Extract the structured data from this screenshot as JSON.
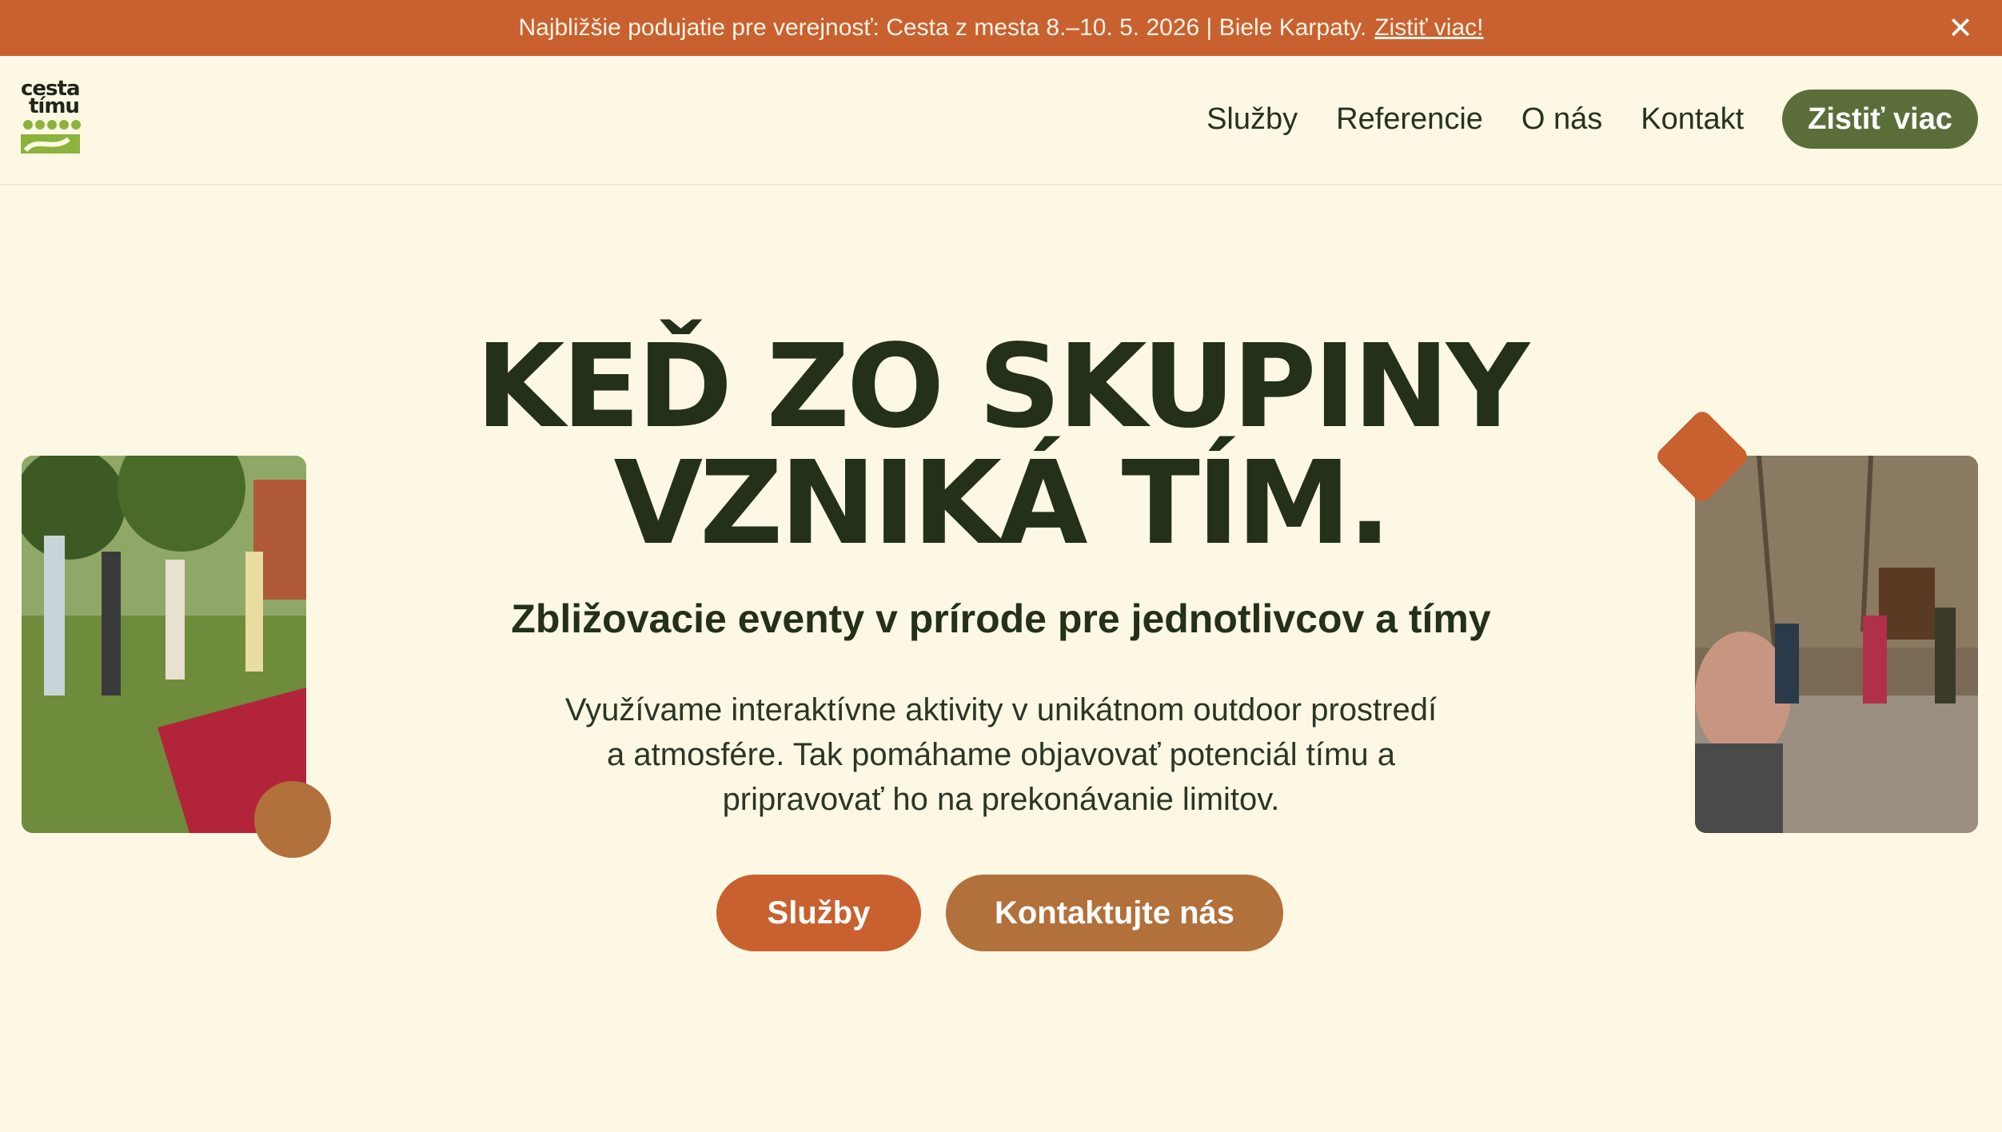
{
  "announcement": {
    "text": "Najbližšie podujatie pre verejnosť: Cesta z mesta 8.–10. 5. 2026 | Biele Karpaty.",
    "link": "Zistiť viac!",
    "close_icon": "close-icon"
  },
  "logo": {
    "line1": "cesta",
    "line2": "tímu"
  },
  "nav": {
    "items": [
      {
        "label": "Služby"
      },
      {
        "label": "Referencie"
      },
      {
        "label": "O nás"
      },
      {
        "label": "Kontakt"
      }
    ],
    "cta": "Zistiť viac"
  },
  "hero": {
    "title_line1": "KEĎ ZO SKUPINY",
    "title_line2": "VZNIKÁ TÍM.",
    "subtitle": "Zbližovacie eventy v prírode pre jednotlivcov a tímy",
    "desc_line1": "Využívame interaktívne aktivity v unikátnom outdoor prostredí",
    "desc_line2": "a atmosfére. Tak pomáhame objavovať potenciál tímu a",
    "desc_line3": "pripravovať ho na prekonávanie limitov.",
    "button_primary": "Služby",
    "button_secondary": "Kontaktujte nás"
  },
  "colors": {
    "background": "#fdf8e4",
    "accent_orange": "#c8612f",
    "accent_brown": "#b2703a",
    "accent_green": "#5b6e3a",
    "text_dark": "#243019"
  }
}
